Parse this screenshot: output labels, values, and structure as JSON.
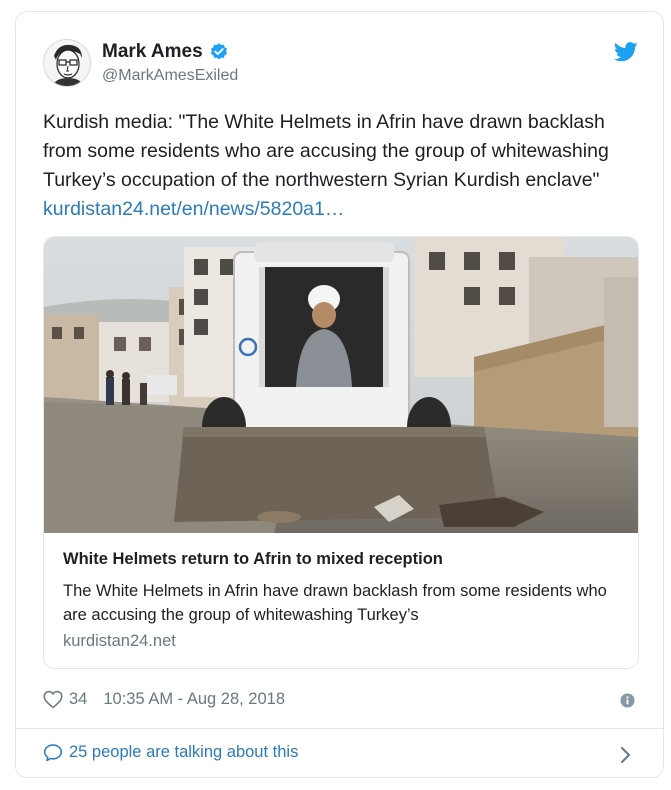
{
  "author": {
    "name": "Mark Ames",
    "handle": "@MarkAmesExiled",
    "avatar_icon": "avatar-portrait",
    "verified_icon": "verified-badge-icon"
  },
  "brand_icon": "twitter-bird-icon",
  "tweet": {
    "text": "Kurdish media: \"The White Helmets in Afrin have drawn backlash from some residents who are accusing the group of whitewashing Turkey’s occupation of the northwestern Syrian Kurdish enclave\" ",
    "link_text": "kurdistan24.net/en/news/5820a1…"
  },
  "link_card": {
    "title": "White Helmets return to Afrin to mixed reception",
    "description": "The White Helmets in Afrin have drawn backlash from some residents who are accusing the group of whitewashing Turkey’s",
    "domain": "kurdistan24.net"
  },
  "meta": {
    "likes": "34",
    "timestamp": "10:35 AM - Aug 28, 2018",
    "info_icon": "info-icon"
  },
  "conversation": {
    "label": "25 people are talking about this",
    "chevron_icon": "chevron-right-icon"
  },
  "colors": {
    "link": "#2b7bb9",
    "muted": "#697882",
    "border": "#e1e8ed",
    "verified": "#1da1f2"
  }
}
